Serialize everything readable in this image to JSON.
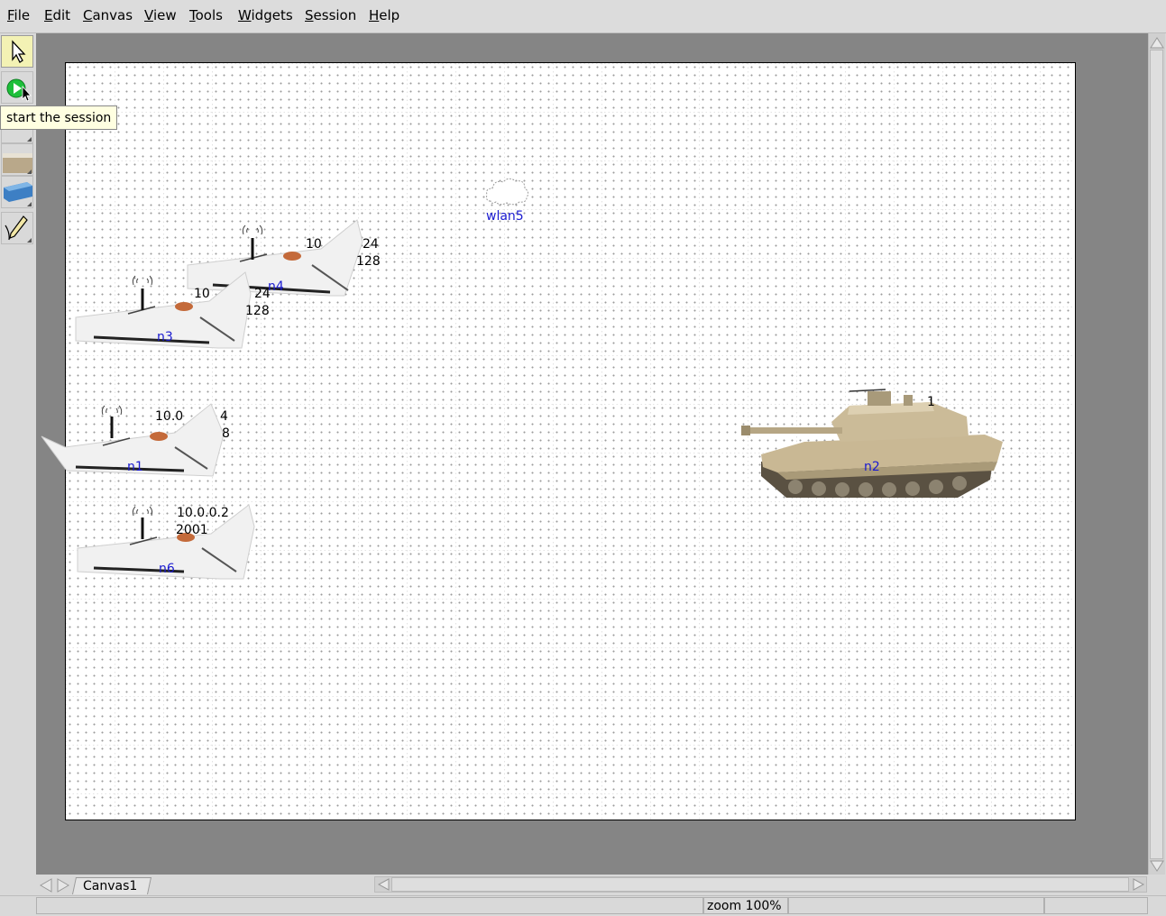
{
  "menu": {
    "file": "File",
    "edit": "Edit",
    "canvas": "Canvas",
    "view": "View",
    "tools": "Tools",
    "widgets": "Widgets",
    "session": "Session",
    "help": "Help"
  },
  "toolbar": {
    "tools": [
      {
        "name": "select-tool",
        "icon": "arrow-cursor-icon",
        "active": true
      },
      {
        "name": "start-session-tool",
        "icon": "green-play-icon",
        "active": false
      },
      {
        "name": "link-tool",
        "icon": "link-icon",
        "active": false
      },
      {
        "name": "node-tool",
        "icon": "router-image-icon",
        "active": false
      },
      {
        "name": "network-tool",
        "icon": "hub-icon",
        "active": false
      },
      {
        "name": "annotation-tool",
        "icon": "pencil-icon",
        "active": false
      }
    ]
  },
  "tooltip": {
    "text": "start the session"
  },
  "nodes": {
    "wlan5": "wlan5",
    "n1": "n1",
    "n2": "n2",
    "n3": "n3",
    "n4": "n4",
    "n6": "n6"
  },
  "addresses": {
    "n4_line1_a": "10",
    "n4_line1_b": "24",
    "n4_line2": "128",
    "n3_line1_a": "10",
    "n3_line1_b": "24",
    "n3_line2": "128",
    "n1_line1_a": "10.0",
    "n1_line1_b": "4",
    "n1_line2": "8",
    "n6_line1": "10.0.0.2",
    "n6_line2": "2001",
    "n2_line1": "1"
  },
  "tabs": {
    "canvas1": "Canvas1"
  },
  "status": {
    "zoom": "zoom 100%"
  },
  "colors": {
    "canvas_bg": "#ffffff",
    "workspace": "#858585",
    "node_label": "#1a1ad0",
    "tooltip_bg": "#ffffe1"
  }
}
